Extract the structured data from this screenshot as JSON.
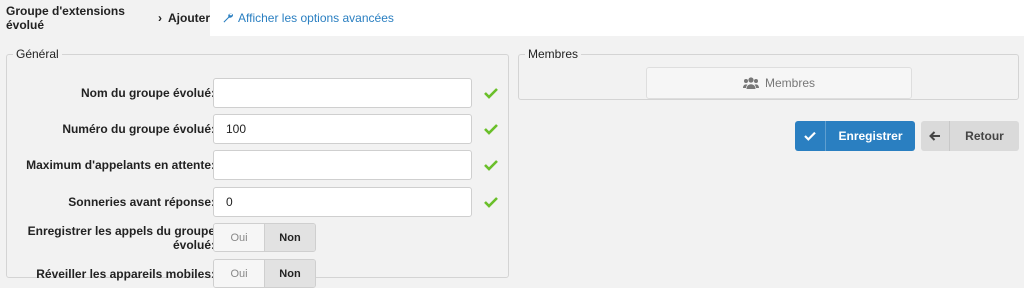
{
  "breadcrumb": {
    "parent": "Groupe d'extensions évolué",
    "separator": "›",
    "current": "Ajouter"
  },
  "advanced_link": "Afficher les options avancées",
  "general": {
    "legend": "Général",
    "fields": [
      {
        "label": "Nom du groupe évolué:",
        "value": "",
        "valid": true
      },
      {
        "label": "Numéro du groupe évolué:",
        "value": "100",
        "valid": true
      },
      {
        "label": "Maximum d'appelants en attente:",
        "value": "",
        "valid": true
      },
      {
        "label": "Sonneries avant réponse:",
        "value": "0",
        "valid": true
      }
    ],
    "toggles": [
      {
        "label_line1": "Enregistrer les appels du groupe",
        "label_line2": "évolué:",
        "off": "Oui",
        "on": "Non",
        "selected": "Non"
      },
      {
        "label": "Réveiller les appareils mobiles:",
        "off": "Oui",
        "on": "Non",
        "selected": "Non"
      }
    ]
  },
  "members": {
    "legend": "Membres",
    "button": "Membres"
  },
  "actions": {
    "save": "Enregistrer",
    "back": "Retour"
  },
  "colors": {
    "accent": "#2a7fc1",
    "valid": "#6abf2a",
    "background": "#f2f2f2"
  }
}
